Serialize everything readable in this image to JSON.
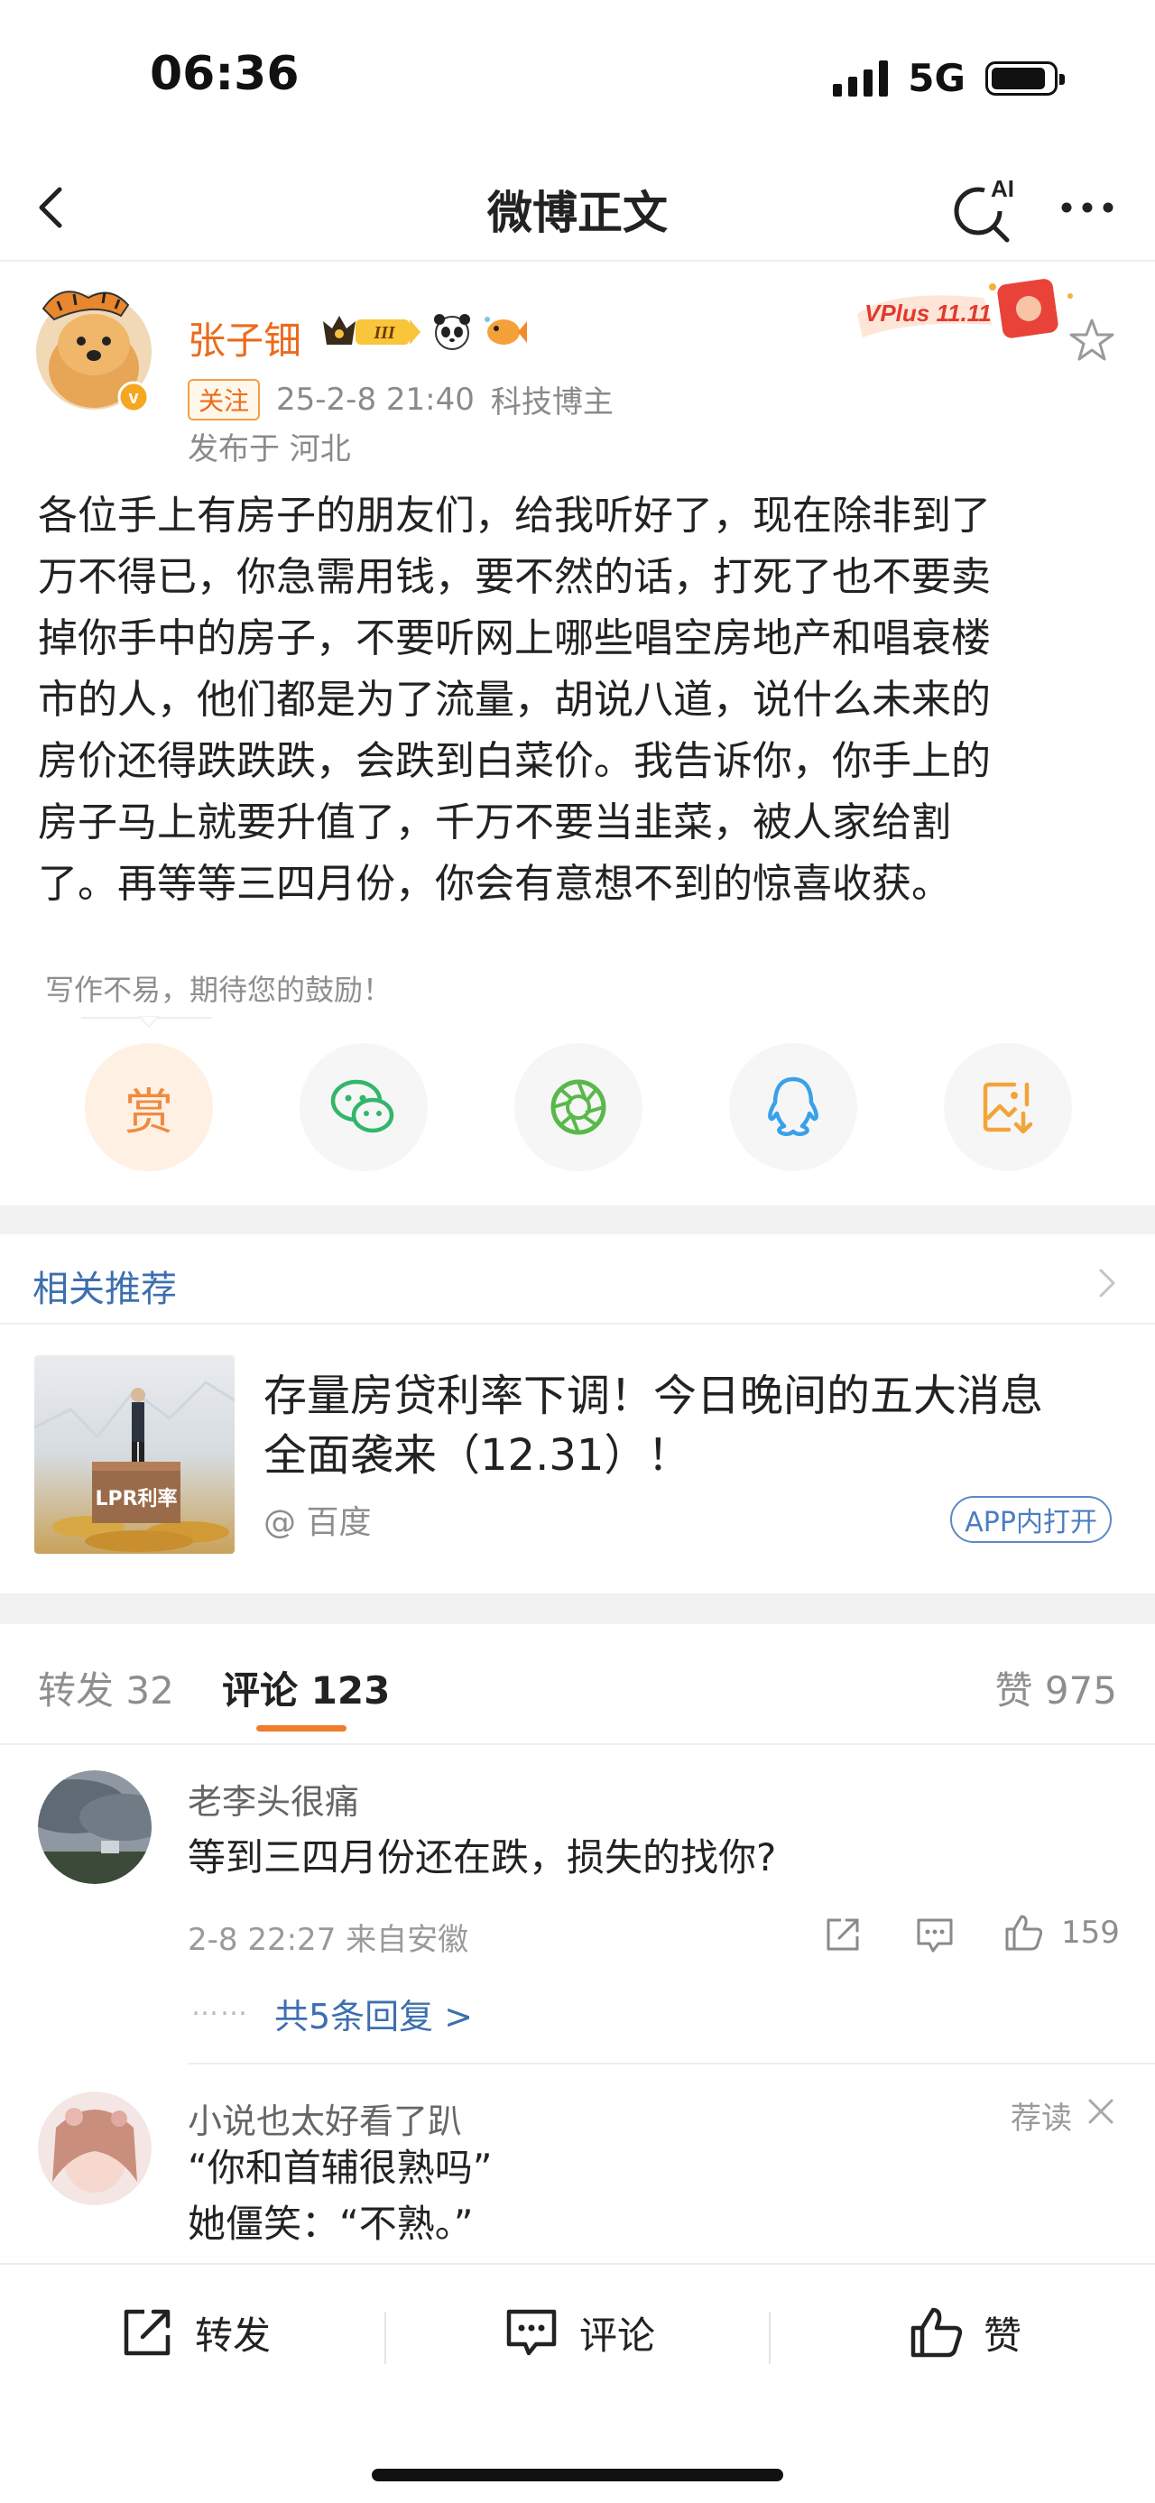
{
  "status_bar": {
    "time": "06:36",
    "network": "5G",
    "battery_level": 0.9,
    "signal_bars": 4
  },
  "nav": {
    "title": "微博正文",
    "ai_label": "AI"
  },
  "post": {
    "author": "张子钿",
    "level_badge": "III",
    "follow_label": "关注",
    "timestamp": "25-2-8 21:40",
    "author_tag": "科技博主",
    "location": "发布于 河北",
    "vplus_label": "VPlus 11.11",
    "body_lines": [
      "各位手上有房子的朋友们，给我听好了，现在除非到了",
      "万不得已，你急需用钱，要不然的话，打死了也不要卖",
      "掉你手中的房子，不要听网上哪些唱空房地产和唱衰楼",
      "市的人，他们都是为了流量，胡说八道，说什么未来的",
      "房价还得跌跌跌，会跌到白菜价。我告诉你，你手上的",
      "房子马上就要升值了，千万不要当韭菜，被人家给割",
      "了。再等等三四月份，你会有意想不到的惊喜收获。"
    ],
    "encourage_text": "写作不易，期待您的鼓励！",
    "reward_label": "赏",
    "share_icons": [
      "wechat-icon",
      "moments-icon",
      "qq-icon",
      "save-image-icon"
    ]
  },
  "related": {
    "title": "相关推荐",
    "items": [
      {
        "thumb_label": "LPR利率",
        "title_lines": [
          "存量房贷利率下调！今日晚间的五大消息",
          "全面袭来（12.31）！"
        ],
        "source": "@ 百度",
        "open_label": "APP内打开"
      }
    ]
  },
  "tabs": {
    "repost": "转发 32",
    "comment": "评论 123",
    "like": "赞 975"
  },
  "comments": [
    {
      "name": "老李头很痛",
      "text": "等到三四月份还在跌，损失的找你?",
      "time": "2-8 22:27 来自安徽",
      "likes": "159",
      "replies_dots": "……",
      "replies": "共5条回复 >"
    },
    {
      "name": "小说也太好看了趴",
      "recommend": "荐读",
      "lines": [
        "“你和首辅很熟吗”",
        "她僵笑：“不熟。”"
      ]
    }
  ],
  "bottom_bar": {
    "repost": "转发",
    "comment": "评论",
    "like": "赞"
  },
  "colors": {
    "accent": "#ec6b1b",
    "link": "#3d6fae",
    "tab_underline": "#ee7d2c"
  }
}
